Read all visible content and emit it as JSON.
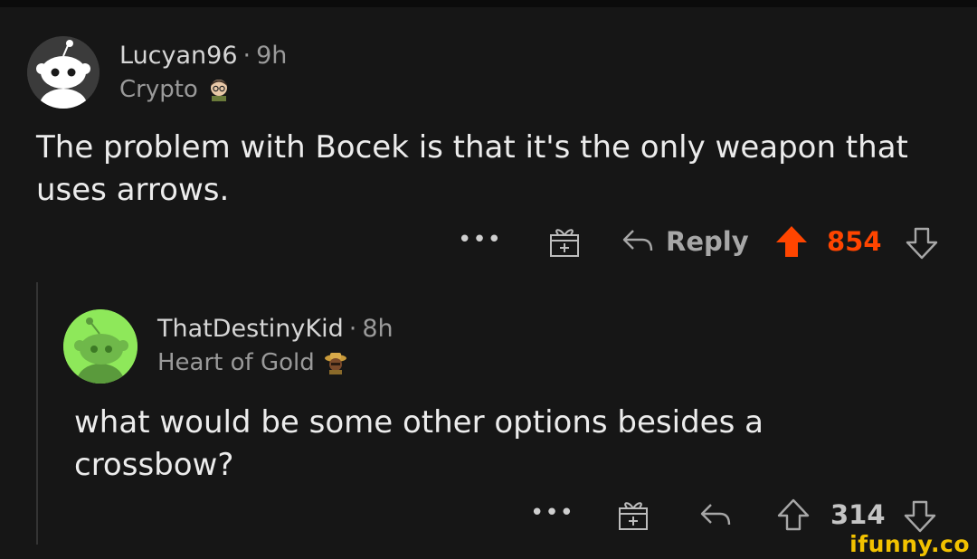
{
  "colors": {
    "background": "#161616",
    "upvoted": "#ff4500",
    "muted": "#9a9a9a",
    "avatar_green": "#8ee85a",
    "watermark": "#f2c200"
  },
  "comments": [
    {
      "username": "Lucyan96",
      "separator": "·",
      "age": "9h",
      "flair": "Crypto",
      "flair_icon": "crypto-avatar-emoji",
      "body_line1": "The problem with Bocek is that it's the only weapon that",
      "body_line2": "uses arrows.",
      "more_label": "•••",
      "award_icon": "gift-icon",
      "reply_label": "Reply",
      "score": "854",
      "vote_state": "upvoted"
    },
    {
      "username": "ThatDestinyKid",
      "separator": "·",
      "age": "8h",
      "flair": "Heart of Gold",
      "flair_icon": "heart-of-gold-emoji",
      "body_line1": "what would be some other options besides a",
      "body_line2": "crossbow?",
      "more_label": "•••",
      "award_icon": "gift-icon",
      "score": "314",
      "vote_state": "none"
    }
  ],
  "watermark": "ifunny.co"
}
